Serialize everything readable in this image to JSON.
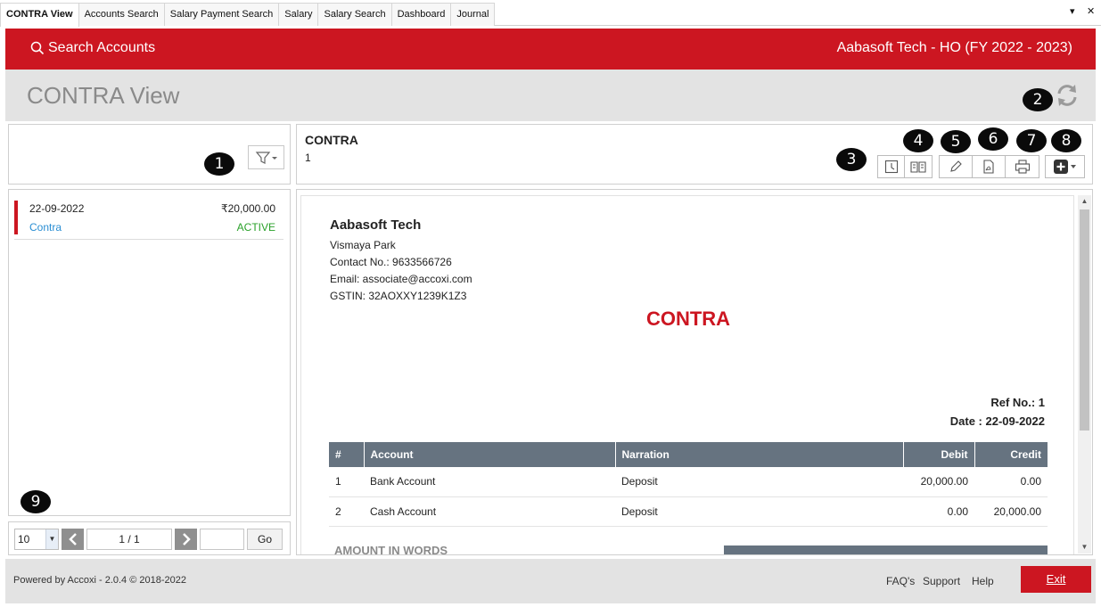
{
  "tabs": [
    "CONTRA View",
    "Accounts Search",
    "Salary Payment Search",
    "Salary",
    "Salary Search",
    "Dashboard",
    "Journal"
  ],
  "tab_controls": {
    "dropdown": "▾",
    "close": "✕"
  },
  "header": {
    "search_label": "Search Accounts",
    "company": "Aabasoft Tech - HO (FY 2022 - 2023)"
  },
  "page": {
    "title": "CONTRA View"
  },
  "badges": [
    "1",
    "2",
    "3",
    "4",
    "5",
    "6",
    "7",
    "8",
    "9"
  ],
  "list": {
    "items": [
      {
        "date": "22-09-2022",
        "amount": "₹20,000.00",
        "type": "Contra",
        "status": "ACTIVE"
      }
    ]
  },
  "pager": {
    "page_size": "10",
    "page_info": "1 / 1",
    "goto_value": "",
    "go_label": "Go"
  },
  "doc_header": {
    "title": "CONTRA",
    "number": "1"
  },
  "voucher": {
    "org_name": "Aabasoft Tech",
    "address": "Vismaya Park",
    "contact": "Contact No.: 9633566726",
    "email": "Email: associate@accoxi.com",
    "gstin": "GSTIN: 32AOXXY1239K1Z3",
    "title": "CONTRA",
    "ref": "Ref No.: 1",
    "date": "Date : 22-09-2022",
    "columns": [
      "#",
      "Account",
      "Narration",
      "Debit",
      "Credit"
    ],
    "rows": [
      {
        "no": "1",
        "account": "Bank Account",
        "narration": "Deposit",
        "debit": "20,000.00",
        "credit": "0.00"
      },
      {
        "no": "2",
        "account": "Cash Account",
        "narration": "Deposit",
        "debit": "0.00",
        "credit": "20,000.00"
      }
    ],
    "amount_in_words_label": "AMOUNT IN WORDS"
  },
  "footer": {
    "powered_by": "Powered by Accoxi - 2.0.4 © 2018-2022",
    "faqs": "FAQ's",
    "support": "Support",
    "help": "Help",
    "exit": "Exit"
  },
  "colors": {
    "brand_red": "#cc1621",
    "table_header": "#667380",
    "status_active": "#2aa12a",
    "link_blue": "#2a8ed3"
  }
}
